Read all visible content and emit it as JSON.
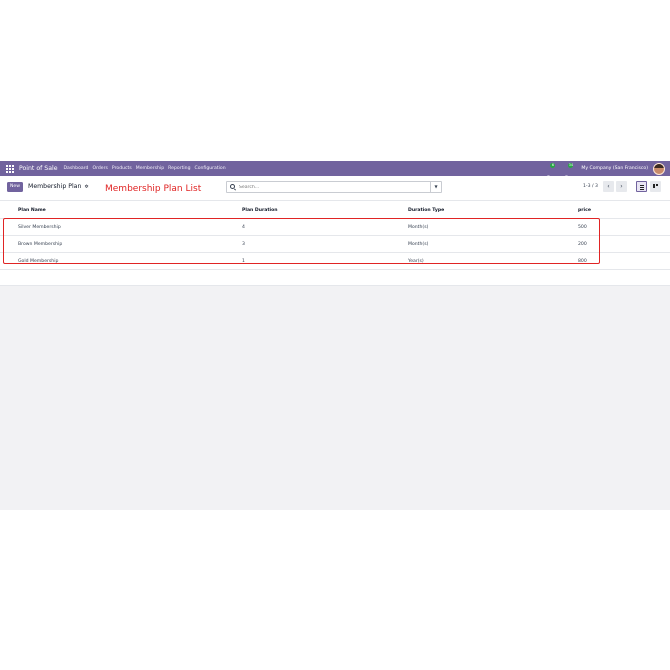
{
  "navbar": {
    "app_name": "Point of Sale",
    "menu": [
      "Dashboard",
      "Orders",
      "Products",
      "Membership",
      "Reporting",
      "Configuration"
    ],
    "messages_badge": "6",
    "activities_badge": "34",
    "company": "My Company (San Francisco)"
  },
  "control": {
    "new_label": "New",
    "title": "Membership Plan",
    "annotation": "Membership Plan List",
    "search_placeholder": "Search...",
    "pager": "1-3 / 3"
  },
  "table": {
    "columns": [
      "Plan Name",
      "Plan Duration",
      "Duration Type",
      "price"
    ],
    "rows": [
      [
        "Silver Membership",
        "4",
        "Month(s)",
        "500"
      ],
      [
        "Brown Membership",
        "3",
        "Month(s)",
        "200"
      ],
      [
        "Gold Membership",
        "1",
        "Year(s)",
        "800"
      ]
    ]
  },
  "colors": {
    "brand": "#71639e",
    "annotation": "#e02424"
  }
}
